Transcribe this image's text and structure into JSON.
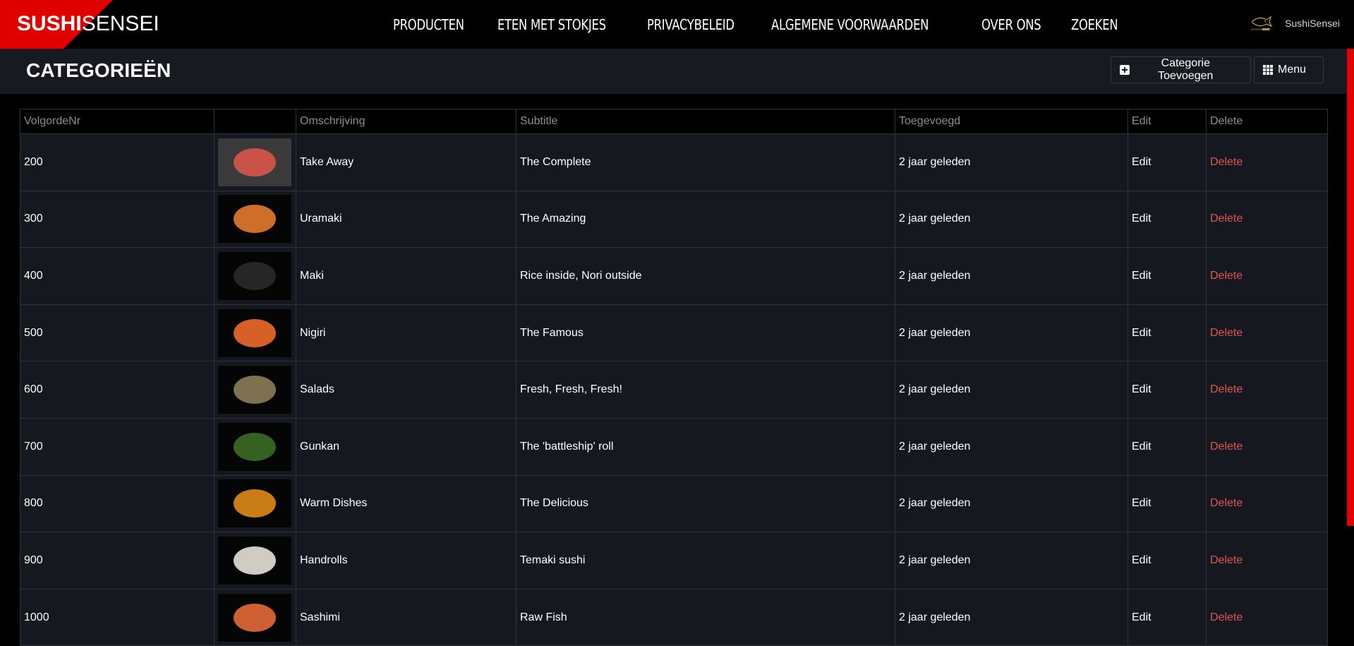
{
  "brand": {
    "logo_bold": "SUSHI",
    "logo_light": "SENSEI",
    "brand_red": "#e10000"
  },
  "nav": {
    "items": [
      {
        "label": "PRODUCTEN"
      },
      {
        "label": "ETEN MET STOKJES"
      },
      {
        "label": "PRIVACYBELEID"
      },
      {
        "label": "ALGEMENE VOORWAARDEN"
      },
      {
        "label": "OVER ONS"
      },
      {
        "label": "ZOEKEN"
      }
    ]
  },
  "user": {
    "name": "SushiSensei",
    "logo_icon": "fish-logo-icon"
  },
  "header": {
    "title": "CATEGORIEËN",
    "add_button": "Categorie Toevoegen",
    "add_icon": "plus-square-icon",
    "menu_button": "Menu",
    "menu_icon": "grid-icon"
  },
  "table": {
    "columns": [
      "VolgordeNr",
      "",
      "Omschrijving",
      "Subtitle",
      "Toegevoegd",
      "Edit",
      "Delete"
    ],
    "rows": [
      {
        "order": "200",
        "image": "take-away-image",
        "name": "Take Away",
        "subtitle": "The Complete",
        "added": "2 jaar geleden",
        "edit": "Edit",
        "delete": "Delete",
        "thumb_color": "#3a3a3a",
        "food_color": "#d9574a"
      },
      {
        "order": "300",
        "image": "uramaki-image",
        "name": "Uramaki",
        "subtitle": "The Amazing",
        "added": "2 jaar geleden",
        "edit": "Edit",
        "delete": "Delete",
        "thumb_color": "#050505",
        "food_color": "#e47a2e"
      },
      {
        "order": "400",
        "image": "maki-image",
        "name": "Maki",
        "subtitle": "Rice inside, Nori outside",
        "added": "2 jaar geleden",
        "edit": "Edit",
        "delete": "Delete",
        "thumb_color": "#050505",
        "food_color": "#2a2a2a"
      },
      {
        "order": "500",
        "image": "nigiri-image",
        "name": "Nigiri",
        "subtitle": "The Famous",
        "added": "2 jaar geleden",
        "edit": "Edit",
        "delete": "Delete",
        "thumb_color": "#050505",
        "food_color": "#ee6a2a"
      },
      {
        "order": "600",
        "image": "salads-image",
        "name": "Salads",
        "subtitle": "Fresh, Fresh, Fresh!",
        "added": "2 jaar geleden",
        "edit": "Edit",
        "delete": "Delete",
        "thumb_color": "#050505",
        "food_color": "#8c7d58"
      },
      {
        "order": "700",
        "image": "gunkan-image",
        "name": "Gunkan",
        "subtitle": "The 'battleship' roll",
        "added": "2 jaar geleden",
        "edit": "Edit",
        "delete": "Delete",
        "thumb_color": "#050505",
        "food_color": "#3b6d23"
      },
      {
        "order": "800",
        "image": "warm-dishes-image",
        "name": "Warm Dishes",
        "subtitle": "The Delicious",
        "added": "2 jaar geleden",
        "edit": "Edit",
        "delete": "Delete",
        "thumb_color": "#050505",
        "food_color": "#e08a1a"
      },
      {
        "order": "900",
        "image": "handrolls-image",
        "name": "Handrolls",
        "subtitle": "Temaki sushi",
        "added": "2 jaar geleden",
        "edit": "Edit",
        "delete": "Delete",
        "thumb_color": "#050505",
        "food_color": "#e8e2d6"
      },
      {
        "order": "1000",
        "image": "sashimi-image",
        "name": "Sashimi",
        "subtitle": "Raw Fish",
        "added": "2 jaar geleden",
        "edit": "Edit",
        "delete": "Delete",
        "thumb_color": "#050505",
        "food_color": "#e46a3a"
      }
    ]
  },
  "colors": {
    "delete_link": "#e0574f",
    "scrollbar": "#e30000",
    "header_bg": "#171a21",
    "row_bg": "#15181f"
  }
}
